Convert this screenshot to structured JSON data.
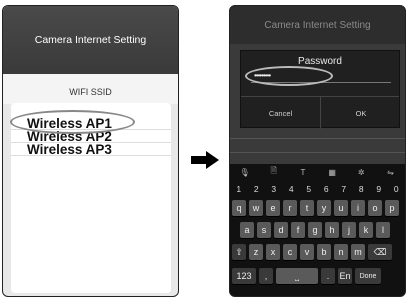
{
  "left_screen": {
    "title": "Camera Internet Setting",
    "ssid_label": "WIFI SSID",
    "networks": [
      "Wireless  AP1",
      "Wireless  AP2",
      "Wireless  AP3"
    ]
  },
  "right_screen": {
    "title": "Camera Internet Setting",
    "dialog": {
      "title": "Password",
      "value": "•••••••••",
      "cancel_label": "Cancel",
      "ok_label": "OK"
    },
    "keyboard": {
      "tools": [
        "🎙",
        "🗎",
        "T",
        "▦",
        "✲",
        "⇋"
      ],
      "numbers": [
        "1",
        "2",
        "3",
        "4",
        "5",
        "6",
        "7",
        "8",
        "9",
        "0"
      ],
      "row1": [
        "q",
        "w",
        "e",
        "r",
        "t",
        "y",
        "u",
        "i",
        "o",
        "p"
      ],
      "row2": [
        "a",
        "s",
        "d",
        "f",
        "g",
        "h",
        "j",
        "k",
        "l"
      ],
      "row3": [
        "z",
        "x",
        "c",
        "v",
        "b",
        "n",
        "m"
      ],
      "shift": "⇧",
      "backspace": "⌫",
      "symbols": "123",
      "comma": ",",
      "space": "⎵",
      "period": ".",
      "lang": "En",
      "done": "Done"
    }
  },
  "colors": {
    "arrow": "#000000"
  }
}
